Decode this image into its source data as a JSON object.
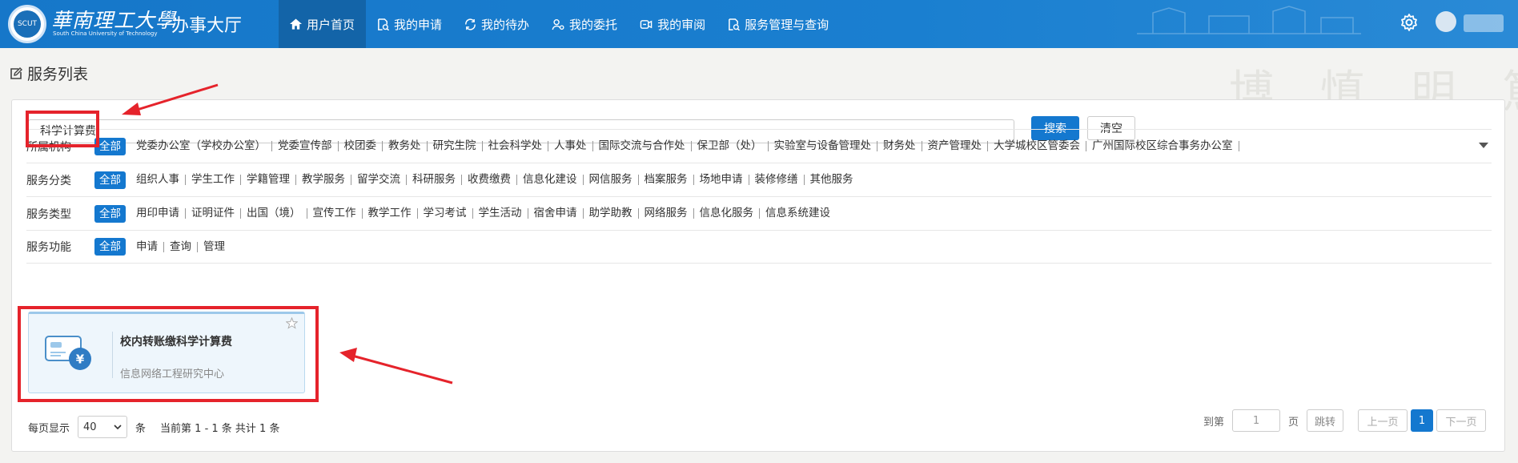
{
  "header": {
    "school_name": "華南理工大學",
    "school_name_en": "South China University of Technology",
    "app_title": "· 办事大厅",
    "logo_text": "SCUT",
    "nav": [
      {
        "label": "用户首页",
        "icon": "home-icon",
        "active": true
      },
      {
        "label": "我的申请",
        "icon": "apply-icon",
        "active": false
      },
      {
        "label": "我的待办",
        "icon": "todo-icon",
        "active": false
      },
      {
        "label": "我的委托",
        "icon": "delegate-icon",
        "active": false
      },
      {
        "label": "我的审阅",
        "icon": "review-icon",
        "active": false
      },
      {
        "label": "服务管理与查询",
        "icon": "manage-icon",
        "active": false
      }
    ],
    "watermark": "博 慎 明 篤"
  },
  "page": {
    "title": "服务列表"
  },
  "search": {
    "value": "科学计算费",
    "search_label": "搜索",
    "clear_label": "清空"
  },
  "filters": [
    {
      "label": "所属机构",
      "all": "全部",
      "items": [
        "党委办公室（学校办公室）",
        "党委宣传部",
        "校团委",
        "教务处",
        "研究生院",
        "社会科学处",
        "人事处",
        "国际交流与合作处",
        "保卫部（处）",
        "实验室与设备管理处",
        "财务处",
        "资产管理处",
        "大学城校区管委会",
        "广州国际校区综合事务办公室"
      ]
    },
    {
      "label": "服务分类",
      "all": "全部",
      "items": [
        "组织人事",
        "学生工作",
        "学籍管理",
        "教学服务",
        "留学交流",
        "科研服务",
        "收费缴费",
        "信息化建设",
        "网信服务",
        "档案服务",
        "场地申请",
        "装修修缮",
        "其他服务"
      ]
    },
    {
      "label": "服务类型",
      "all": "全部",
      "items": [
        "用印申请",
        "证明证件",
        "出国（境）",
        "宣传工作",
        "教学工作",
        "学习考试",
        "学生活动",
        "宿舍申请",
        "助学助教",
        "网络服务",
        "信息化服务",
        "信息系统建设"
      ]
    },
    {
      "label": "服务功能",
      "all": "全部",
      "items": [
        "申请",
        "查询",
        "管理"
      ]
    }
  ],
  "card": {
    "title": "校内转账缴科学计算费",
    "dept": "信息网络工程研究中心",
    "icon_text": "¥"
  },
  "pager": {
    "per_page_label": "每页显示",
    "per_page_value": "40",
    "unit": "条",
    "summary": "当前第 1 - 1 条 共计 1 条",
    "goto_label": "到第",
    "goto_value": "1",
    "page_unit": "页",
    "jump_label": "跳转",
    "prev_label": "上一页",
    "current_page": "1",
    "next_label": "下一页"
  },
  "colors": {
    "header": "#1677c9",
    "accent": "#1478cf",
    "annotation": "#e5232b"
  }
}
